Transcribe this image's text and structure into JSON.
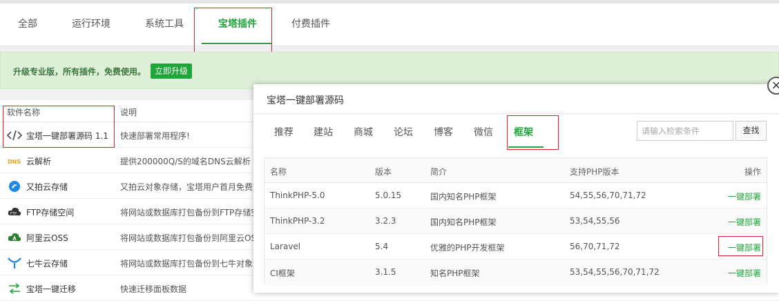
{
  "tabs": [
    {
      "label": "全部"
    },
    {
      "label": "运行环境"
    },
    {
      "label": "系统工具"
    },
    {
      "label": "宝塔插件"
    },
    {
      "label": "付费插件"
    }
  ],
  "promo": {
    "text": "升级专业版，所有插件，免费使用。",
    "button": "立即升级"
  },
  "table": {
    "headers": {
      "name": "软件名称",
      "desc": "说明"
    },
    "rows": [
      {
        "icon": "code-icon",
        "name": "宝塔一键部署源码 1.1",
        "desc": "快速部署常用程序!"
      },
      {
        "icon": "dns-icon",
        "name": "云解析",
        "desc": "提供200000Q/S的域名DNS云解析"
      },
      {
        "icon": "upyun-icon",
        "name": "又拍云存储",
        "desc": "又拍云对象存储，宝塔用户首月免费"
      },
      {
        "icon": "ftp-icon",
        "name": "FTP存储空间",
        "desc": "将网站或数据库打包备份到FTP存储空"
      },
      {
        "icon": "aliyun-icon",
        "name": "阿里云OSS",
        "desc": "将网站或数据库打包备份到阿里云OS"
      },
      {
        "icon": "qiniu-icon",
        "name": "七牛云存储",
        "desc": "将网站或数据库打包备份到七牛对象"
      },
      {
        "icon": "migrate-icon",
        "name": "宝塔一键迁移",
        "desc": "快速迁移面板数据"
      }
    ]
  },
  "modal": {
    "title": "宝塔一键部署源码",
    "tabs": [
      {
        "label": "推荐"
      },
      {
        "label": "建站"
      },
      {
        "label": "商城"
      },
      {
        "label": "论坛"
      },
      {
        "label": "博客"
      },
      {
        "label": "微信"
      },
      {
        "label": "框架"
      }
    ],
    "search": {
      "placeholder": "请输入检索条件",
      "button": "查找"
    },
    "headers": {
      "name": "名称",
      "version": "版本",
      "intro": "简介",
      "php": "支持PHP版本",
      "action": "操作"
    },
    "rows": [
      {
        "name": "ThinkPHP-5.0",
        "version": "5.0.15",
        "intro": "国内知名PHP框架",
        "php": "54,55,56,70,71,72",
        "action": "一键部署"
      },
      {
        "name": "ThinkPHP-3.2",
        "version": "3.2.3",
        "intro": "国内知名PHP框架",
        "php": "53,54,55,56",
        "action": "一键部署"
      },
      {
        "name": "Laravel",
        "version": "5.4",
        "intro": "优雅的PHP开发框架",
        "php": "56,70,71,72",
        "action": "一键部署"
      },
      {
        "name": "CI框架",
        "version": "3.1.5",
        "intro": "知名PHP框架",
        "php": "53,54,55,56,70,71,72",
        "action": "一键部署"
      }
    ]
  },
  "colors": {
    "accent": "#20a53a",
    "highlight": "#e02020"
  }
}
